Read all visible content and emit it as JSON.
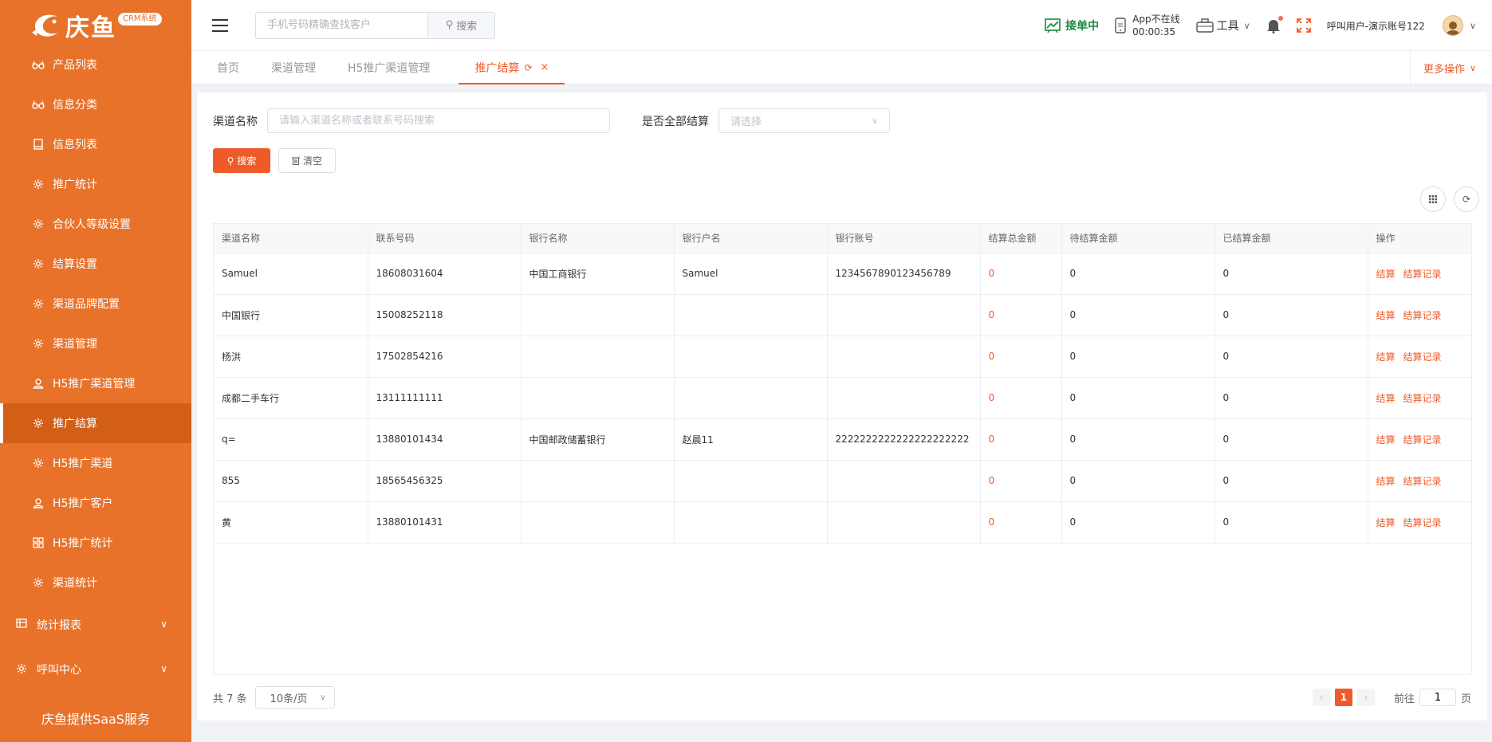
{
  "brand": {
    "name": "庆鱼",
    "badge": "CRM系统"
  },
  "sidebar": {
    "items": [
      {
        "label": "产品列表",
        "icon": "glasses-icon"
      },
      {
        "label": "信息分类",
        "icon": "glasses-icon"
      },
      {
        "label": "信息列表",
        "icon": "book-icon"
      },
      {
        "label": "推广统计",
        "icon": "gear-icon"
      },
      {
        "label": "合伙人等级设置",
        "icon": "gear-icon"
      },
      {
        "label": "结算设置",
        "icon": "gear-icon"
      },
      {
        "label": "渠道品牌配置",
        "icon": "gear-icon"
      },
      {
        "label": "渠道管理",
        "icon": "gear-icon"
      },
      {
        "label": "H5推广渠道管理",
        "icon": "user-icon"
      },
      {
        "label": "推广结算",
        "icon": "gear-icon",
        "active": true
      },
      {
        "label": "H5推广渠道",
        "icon": "gear-icon"
      },
      {
        "label": "H5推广客户",
        "icon": "user-icon"
      },
      {
        "label": "H5推广统计",
        "icon": "grid-icon"
      },
      {
        "label": "渠道统计",
        "icon": "gear-icon"
      }
    ],
    "groups": [
      {
        "label": "统计报表",
        "icon": "table-icon"
      },
      {
        "label": "呼叫中心",
        "icon": "gear-icon"
      }
    ],
    "footer": "庆鱼提供SaaS服务"
  },
  "header": {
    "search_placeholder": "手机号码精确查找客户",
    "search_label": "搜索",
    "status_label": "接单中",
    "app_status": "App不在线",
    "app_timer": "00:00:35",
    "tools_label": "工具",
    "user_label": "呼叫用户-演示账号122"
  },
  "tabs": {
    "items": [
      "首页",
      "渠道管理",
      "H5推广渠道管理",
      "推广结算"
    ],
    "active_index": 3,
    "more_label": "更多操作"
  },
  "filters": {
    "channel_label": "渠道名称",
    "channel_placeholder": "请输入渠道名称或者联系号码搜索",
    "settled_label": "是否全部结算",
    "settled_placeholder": "请选择",
    "search_btn": "搜索",
    "clear_btn": "清空"
  },
  "table": {
    "columns": [
      "渠道名称",
      "联系号码",
      "银行名称",
      "银行户名",
      "银行账号",
      "结算总金额",
      "待结算金额",
      "已结算金额",
      "操作"
    ],
    "rows": [
      [
        "Samuel",
        "18608031604",
        "中国工商银行",
        "Samuel",
        "1234567890123456789",
        "0",
        "0",
        "0"
      ],
      [
        "中国银行",
        "15008252118",
        "",
        "",
        "",
        "0",
        "0",
        "0"
      ],
      [
        "杨洪",
        "17502854216",
        "",
        "",
        "",
        "0",
        "0",
        "0"
      ],
      [
        "成都二手车行",
        "13111111111",
        "",
        "",
        "",
        "0",
        "0",
        "0"
      ],
      [
        "q=",
        "13880101434",
        "中国邮政储蓄银行",
        "赵晨11",
        "2222222222222222222222",
        "0",
        "0",
        "0"
      ],
      [
        "855",
        "18565456325",
        "",
        "",
        "",
        "0",
        "0",
        "0"
      ],
      [
        "黄",
        "13880101431",
        "",
        "",
        "",
        "0",
        "0",
        "0"
      ]
    ],
    "op_settle": "结算",
    "op_record": "结算记录"
  },
  "pagination": {
    "total": "共 7 条",
    "page_size": "10条/页",
    "current_page": "1",
    "goto_label": "前往",
    "goto_value": "1",
    "page_suffix": "页"
  },
  "colors": {
    "sidebar": "#e8722a",
    "accent": "#f05a28",
    "active_item": "#d35e16"
  }
}
